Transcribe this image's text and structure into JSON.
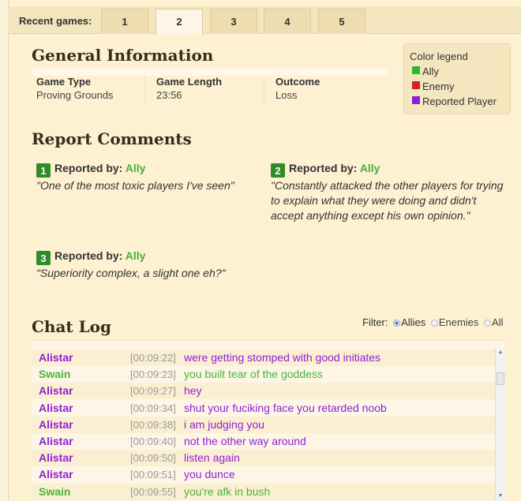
{
  "tabs": {
    "label": "Recent games:",
    "items": [
      "1",
      "2",
      "3",
      "4",
      "5"
    ],
    "active": "2"
  },
  "general": {
    "title": "General Information",
    "game_type_label": "Game Type",
    "game_type": "Proving Grounds",
    "length_label": "Game Length",
    "length": "23:56",
    "outcome_label": "Outcome",
    "outcome": "Loss"
  },
  "legend": {
    "title": "Color legend",
    "ally": "Ally",
    "enemy": "Enemy",
    "reported": "Reported Player",
    "colors": {
      "ally": "#2fb62c",
      "enemy": "#d42020",
      "reported": "#8b1ee0"
    }
  },
  "reports": {
    "title": "Report Comments",
    "prefix": "Reported by:",
    "items": [
      {
        "num": "1",
        "by": "Ally",
        "comment": "\"One of the most toxic players I've seen\""
      },
      {
        "num": "2",
        "by": "Ally",
        "comment": "\"Constantly attacked the other players for trying to explain what they were doing and didn't accept anything except his own opinion.\""
      },
      {
        "num": "3",
        "by": "Ally",
        "comment": "\"Superiority complex, a slight one eh?\""
      }
    ]
  },
  "chat": {
    "title": "Chat Log",
    "filter_label": "Filter:",
    "filter_allies": "Allies",
    "filter_enemies": "Enemies",
    "filter_all": "All",
    "filter_selected": "Allies",
    "rows": [
      {
        "name": "Alistar",
        "time": "[00:09:22]",
        "msg": "were getting stomped with good initiates",
        "color": "purple"
      },
      {
        "name": "Swain",
        "time": "[00:09:23]",
        "msg": "you built tear of the goddess",
        "color": "green"
      },
      {
        "name": "Alistar",
        "time": "[00:09:27]",
        "msg": "hey",
        "color": "purple"
      },
      {
        "name": "Alistar",
        "time": "[00:09:34]",
        "msg": "shut your fuciking face you retarded noob",
        "color": "purple"
      },
      {
        "name": "Alistar",
        "time": "[00:09:38]",
        "msg": "i am judging you",
        "color": "purple"
      },
      {
        "name": "Alistar",
        "time": "[00:09:40]",
        "msg": "not the other way around",
        "color": "purple"
      },
      {
        "name": "Alistar",
        "time": "[00:09:50]",
        "msg": "listen again",
        "color": "purple"
      },
      {
        "name": "Alistar",
        "time": "[00:09:51]",
        "msg": "you dunce",
        "color": "purple"
      },
      {
        "name": "Swain",
        "time": "[00:09:55]",
        "msg": "you're afk in bush",
        "color": "green"
      }
    ]
  }
}
